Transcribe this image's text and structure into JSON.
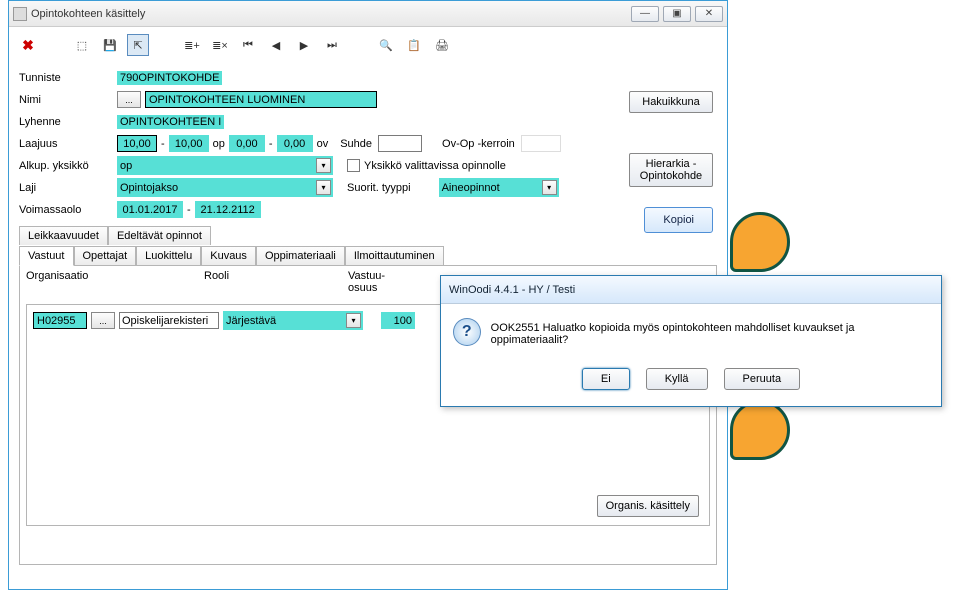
{
  "window": {
    "title": "Opintokohteen käsittely",
    "min": "—",
    "max": "▣",
    "close": "✕"
  },
  "toolbar": {
    "close_icon": "✖",
    "t1": "⬚",
    "t2": "💾",
    "t3": "⇱",
    "n1": "≣+",
    "n2": "≣×",
    "n3": "⏮",
    "n4": "◀",
    "n5": "▶",
    "n6": "⏭",
    "s1": "🔍",
    "s2": "📋",
    "s3": "🖨"
  },
  "labels": {
    "tunniste": "Tunniste",
    "nimi": "Nimi",
    "lyhenne": "Lyhenne",
    "laajuus": "Laajuus",
    "alkup_yksikko": "Alkup. yksikkö",
    "laji": "Laji",
    "voimassaolo": "Voimassaolo",
    "op": "op",
    "ov": "ov",
    "suhde": "Suhde",
    "ovop": "Ov-Op -kerroin",
    "yksikko_check": "Yksikkö valittavissa opinnolle",
    "suorit": "Suorit. tyyppi"
  },
  "values": {
    "tunniste": "790OPINTOKOHDE",
    "nimi": "OPINTOKOHTEEN LUOMINEN",
    "lyhenne": "OPINTOKOHTEEN I",
    "laajuus_op_from": "10,00",
    "laajuus_op_to": "10,00",
    "laajuus_ov_from": "0,00",
    "laajuus_ov_to": "0,00",
    "suhde": "",
    "ovop": "",
    "alkup_yksikko": "op",
    "laji": "Opintojakso",
    "suorit": "Aineopinnot",
    "voimassa_from": "01.01.2017",
    "voimassa_to": "21.12.2112",
    "ellipsis": "..."
  },
  "buttons": {
    "hakuikkuna": "Hakuikkuna",
    "hierarkia": "Hierarkia - Opintokohde",
    "kopioi": "Kopioi",
    "organis": "Organis. käsittely"
  },
  "tabs_top": {
    "leikkaavuudet": "Leikkaavuudet",
    "edeltavat": "Edeltävät opinnot"
  },
  "tabs": {
    "vastuut": "Vastuut",
    "opettajat": "Opettajat",
    "luokittelu": "Luokittelu",
    "kuvaus": "Kuvaus",
    "oppimateriaali": "Oppimateriaali",
    "ilmoittautuminen": "Ilmoittautuminen"
  },
  "grid": {
    "h1": "Organisaatio",
    "h2": "Rooli",
    "h3": "Vastuu-\nosuus",
    "org_code": "H02955",
    "org_name": "Opiskelijarekisteri",
    "role": "Järjestävä",
    "share": "100"
  },
  "dialog": {
    "title": "WinOodi 4.4.1  -  HY / Testi",
    "message": "OOK2551 Haluatko kopioida myös opintokohteen mahdolliset kuvaukset ja oppimateriaalit?",
    "ei": "Ei",
    "kylla": "Kyllä",
    "peruuta": "Peruuta"
  }
}
